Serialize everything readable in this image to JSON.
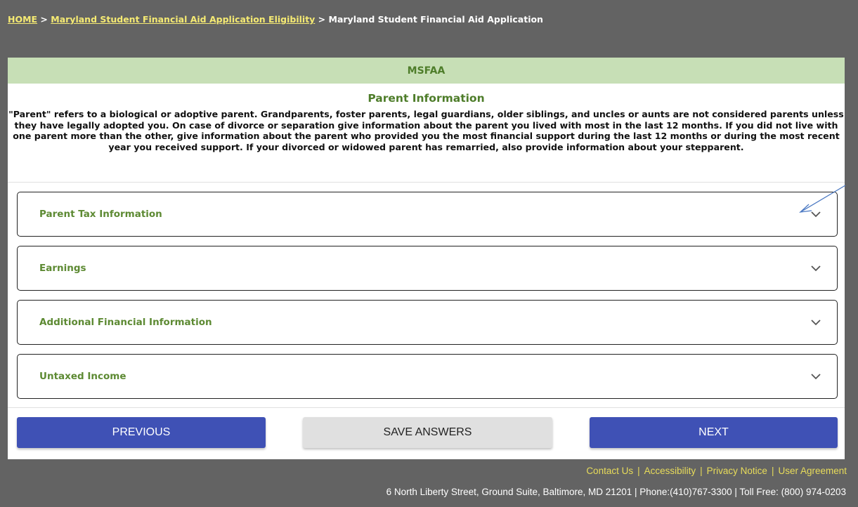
{
  "breadcrumb": {
    "home": "HOME",
    "sep1": " > ",
    "eligibility": "Maryland Student Financial Aid Application Eligibility",
    "sep2": " > ",
    "current": "Maryland Student Financial Aid Application"
  },
  "card": {
    "header": "MSFAA",
    "section_title": "Parent Information",
    "intro": "\"Parent\" refers to a biological or adoptive parent. Grandparents, foster parents, legal guardians, older siblings, and uncles or aunts are not considered parents unless they have legally adopted you. On case of divorce or separation give information about the parent you lived with most in the last 12 months. If you did not live with one parent more than the other, give information about the parent who provided you the most financial support during the last 12 months or during the most recent year you received support. If your divorced or widowed parent has remarried, also provide information about your stepparent."
  },
  "accordions": [
    {
      "label": "Parent Tax Information",
      "icon": "chevron-down-icon"
    },
    {
      "label": "Earnings",
      "icon": "chevron-down-icon"
    },
    {
      "label": "Additional Financial Information",
      "icon": "chevron-down-icon"
    },
    {
      "label": "Untaxed Income",
      "icon": "chevron-down-icon"
    }
  ],
  "buttons": {
    "previous": "PREVIOUS",
    "save": "SAVE ANSWERS",
    "next": "NEXT"
  },
  "footer": {
    "links": [
      "Contact Us",
      "Accessibility",
      "Privacy Notice",
      "User Agreement"
    ],
    "separator": "|",
    "address": "6 North Liberty Street, Ground Suite, Baltimore, MD 21201  |  Phone:(410)767-3300 | Toll Free: (800) 974-0203"
  },
  "colors": {
    "page_bg": "#636363",
    "header_bg": "#c7dfb6",
    "accent_green": "#5d8a33",
    "primary_button": "#3f51b5",
    "link_yellow": "#f5ea73"
  }
}
